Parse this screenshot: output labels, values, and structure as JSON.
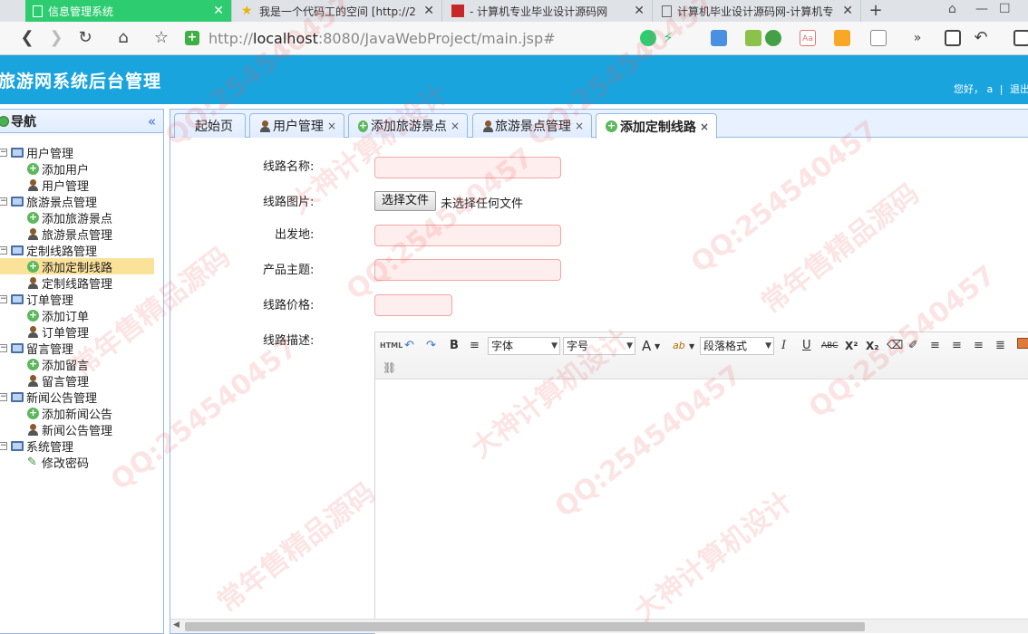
{
  "browser": {
    "tabs": [
      {
        "title": "信息管理系统",
        "active": true
      },
      {
        "title": "我是一个代码工的空间 [http://2",
        "active": false
      },
      {
        "title": "- 计算机专业毕业设计源码网",
        "active": false
      },
      {
        "title": "计算机毕业设计源码网-计算机专",
        "active": false
      }
    ],
    "new_tab": "+",
    "url_prefix": "http://",
    "url_host": "localhost",
    "url_rest": ":8080/JavaWebProject/main.jsp#"
  },
  "app": {
    "title": "旅游网系统后台管理",
    "greeting": "您好，",
    "user": "a",
    "separator": "|",
    "logout": "退出"
  },
  "sidebar": {
    "title": "导航",
    "collapse": "«",
    "groups": [
      {
        "label": "用户管理",
        "items": [
          {
            "label": "添加用户",
            "icon": "add"
          },
          {
            "label": "用户管理",
            "icon": "user"
          }
        ]
      },
      {
        "label": "旅游景点管理",
        "items": [
          {
            "label": "添加旅游景点",
            "icon": "add"
          },
          {
            "label": "旅游景点管理",
            "icon": "user"
          }
        ]
      },
      {
        "label": "定制线路管理",
        "items": [
          {
            "label": "添加定制线路",
            "icon": "add",
            "selected": true
          },
          {
            "label": "定制线路管理",
            "icon": "user"
          }
        ]
      },
      {
        "label": "订单管理",
        "items": [
          {
            "label": "添加订单",
            "icon": "add"
          },
          {
            "label": "订单管理",
            "icon": "user"
          }
        ]
      },
      {
        "label": "留言管理",
        "items": [
          {
            "label": "添加留言",
            "icon": "add"
          },
          {
            "label": "留言管理",
            "icon": "user"
          }
        ]
      },
      {
        "label": "新闻公告管理",
        "items": [
          {
            "label": "添加新闻公告",
            "icon": "add"
          },
          {
            "label": "新闻公告管理",
            "icon": "user"
          }
        ]
      },
      {
        "label": "系统管理",
        "items": [
          {
            "label": "修改密码",
            "icon": "pen"
          }
        ]
      }
    ]
  },
  "content_tabs": [
    {
      "label": "起始页",
      "icon": "none",
      "closable": false
    },
    {
      "label": "用户管理",
      "icon": "user",
      "closable": true
    },
    {
      "label": "添加旅游景点",
      "icon": "add",
      "closable": true
    },
    {
      "label": "旅游景点管理",
      "icon": "user",
      "closable": true
    },
    {
      "label": "添加定制线路",
      "icon": "add",
      "closable": true,
      "active": true
    }
  ],
  "form": {
    "name_label": "线路名称:",
    "image_label": "线路图片:",
    "file_button": "选择文件",
    "file_status": "未选择任何文件",
    "origin_label": "出发地:",
    "theme_label": "产品主题:",
    "price_label": "线路价格:",
    "desc_label": "线路描述:"
  },
  "editor": {
    "html_btn": "HTML",
    "bold": "B",
    "font_family": "字体",
    "font_size": "字号",
    "font_color": "A",
    "highlight": "ab",
    "paragraph": "段落格式",
    "italic": "I",
    "underline": "U",
    "strike": "ABC",
    "superscript": "X²",
    "subscript": "X₂"
  },
  "watermarks": [
    "QQ:254540457",
    "大神计算机设计",
    "常年售精品源码"
  ]
}
